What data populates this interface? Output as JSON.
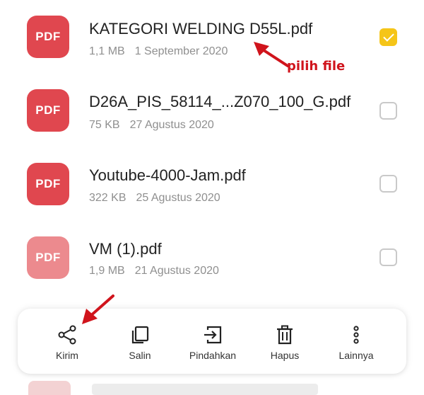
{
  "files": [
    {
      "icon_text": "PDF",
      "name": "KATEGORI WELDING D55L.pdf",
      "size": "1,1 MB",
      "date": "1 September 2020",
      "checked": true
    },
    {
      "icon_text": "PDF",
      "name": "D26A_PIS_58114_...Z070_100_G.pdf",
      "size": "75 KB",
      "date": "27 Agustus 2020",
      "checked": false
    },
    {
      "icon_text": "PDF",
      "name": "Youtube-4000-Jam.pdf",
      "size": "322 KB",
      "date": "25 Agustus 2020",
      "checked": false
    },
    {
      "icon_text": "PDF",
      "name": "VM (1).pdf",
      "size": "1,9 MB",
      "date": "21 Agustus 2020",
      "checked": false
    }
  ],
  "annotation": {
    "text": "pilih file",
    "color": "#d0141c"
  },
  "actions": [
    {
      "label": "Kirim",
      "icon": "share-icon"
    },
    {
      "label": "Salin",
      "icon": "copy-icon"
    },
    {
      "label": "Pindahkan",
      "icon": "move-icon"
    },
    {
      "label": "Hapus",
      "icon": "trash-icon"
    },
    {
      "label": "Lainnya",
      "icon": "more-vertical-icon"
    }
  ],
  "colors": {
    "pdf_red": "#e0474f",
    "checkbox_accent": "#f5c518"
  }
}
